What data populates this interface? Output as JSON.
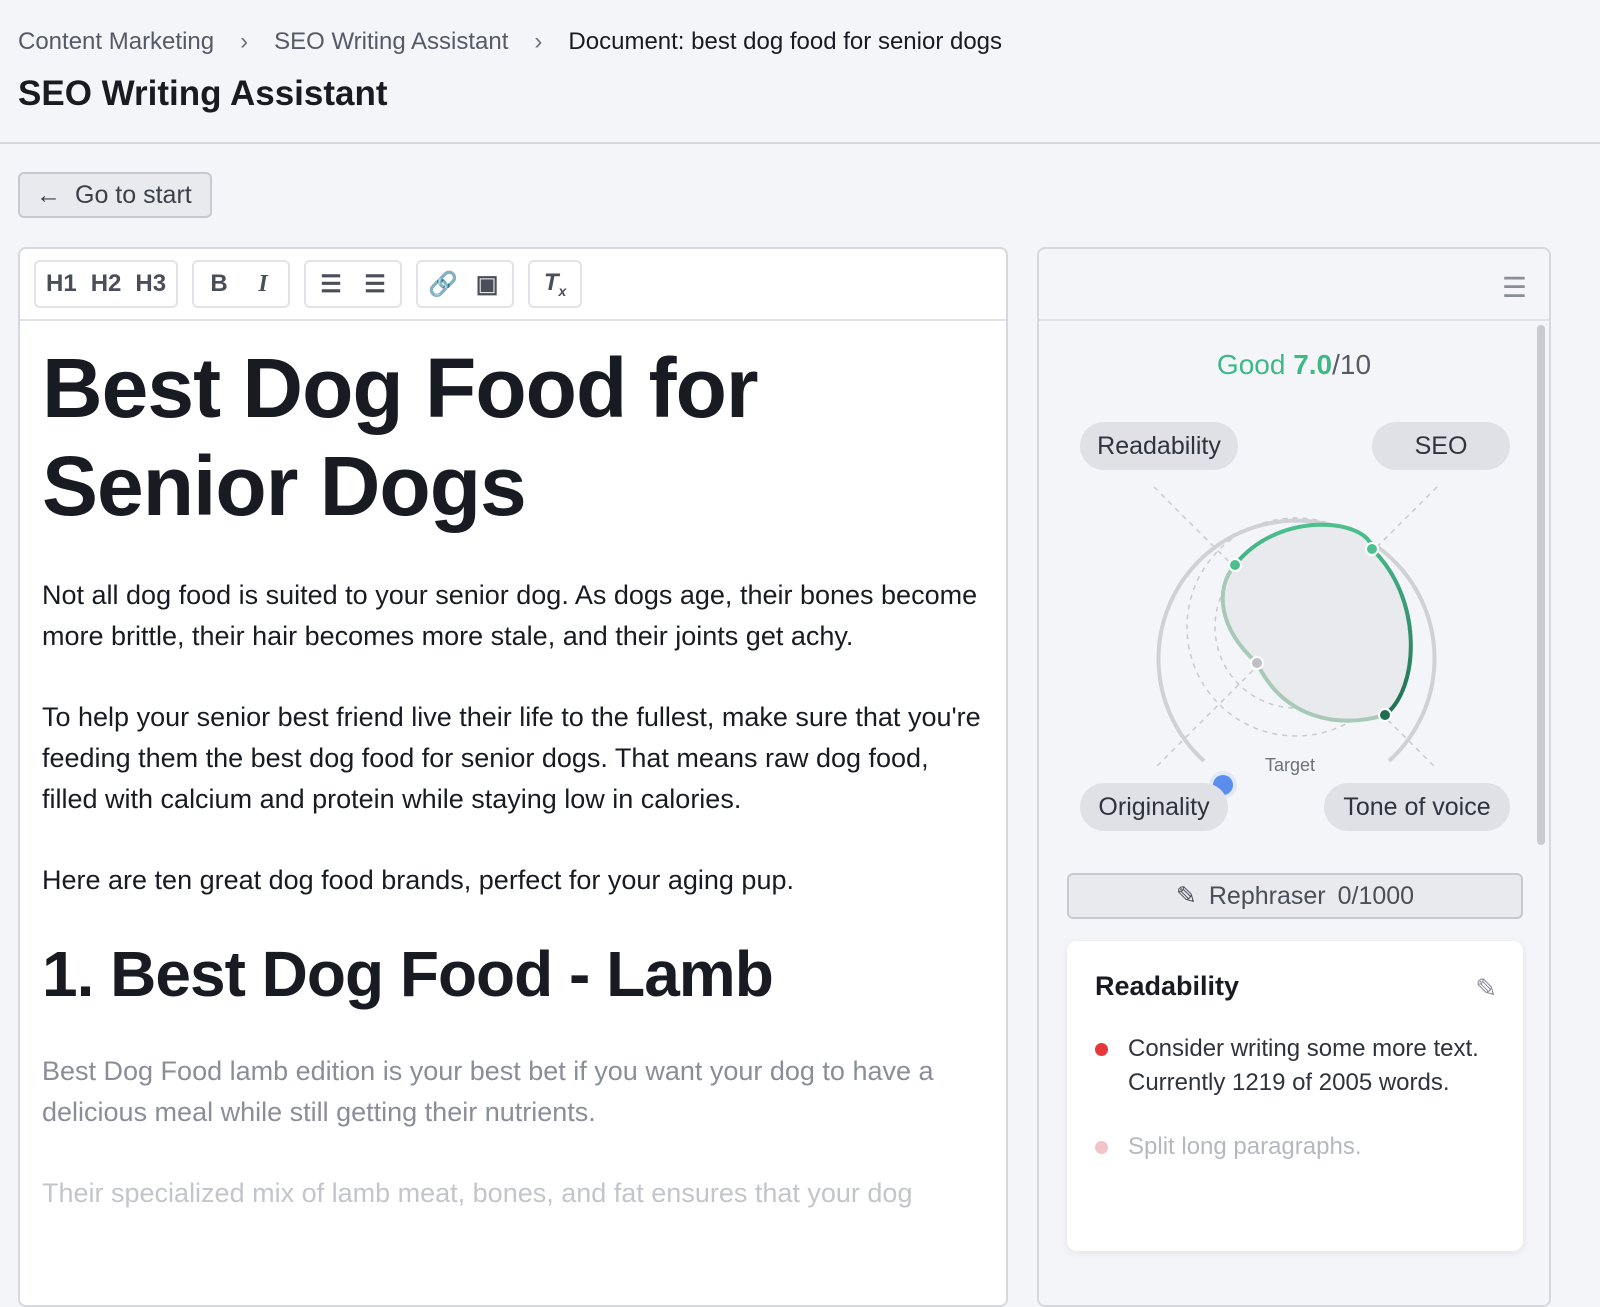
{
  "breadcrumb": [
    "Content Marketing",
    "SEO Writing Assistant",
    "Document: best dog food for senior dogs"
  ],
  "page_title": "SEO Writing Assistant",
  "back_button": "Go to start",
  "toolbar": {
    "h1": "H1",
    "h2": "H2",
    "h3": "H3",
    "bold": "B",
    "italic": "I"
  },
  "document": {
    "title": "Best Dog Food for Senior Dogs",
    "paragraphs": [
      "Not all dog food is suited to your senior dog. As dogs age, their bones become more brittle, their hair becomes more stale, and their joints get achy.",
      "To help your senior best friend live their life to the fullest, make sure that you're feeding them the best dog food for senior dogs. That means raw dog food, filled with calcium and protein while staying low in calories.",
      "Here are ten great dog food brands, perfect for your aging pup."
    ],
    "section_heading": "1. Best Dog Food - Lamb",
    "section_paragraphs": [
      "Best Dog Food lamb edition is your best bet if you want your dog to have a delicious meal while still getting their nutrients.",
      "Their specialized mix of lamb meat, bones, and fat ensures that your dog"
    ]
  },
  "panel": {
    "score_label": "Good",
    "score": "7.0",
    "score_max": "/10",
    "axes": [
      "Readability",
      "SEO",
      "Originality",
      "Tone of voice"
    ],
    "target_label": "Target",
    "rephraser": "Rephraser",
    "rephraser_count": "0/1000",
    "card_title": "Readability",
    "issues": [
      "Consider writing some more text. Currently 1219 of 2005 words.",
      "Split long paragraphs."
    ],
    "colors": {
      "good": "#3fb984",
      "issue": "#e5383b",
      "originality": "#5b8def"
    }
  }
}
